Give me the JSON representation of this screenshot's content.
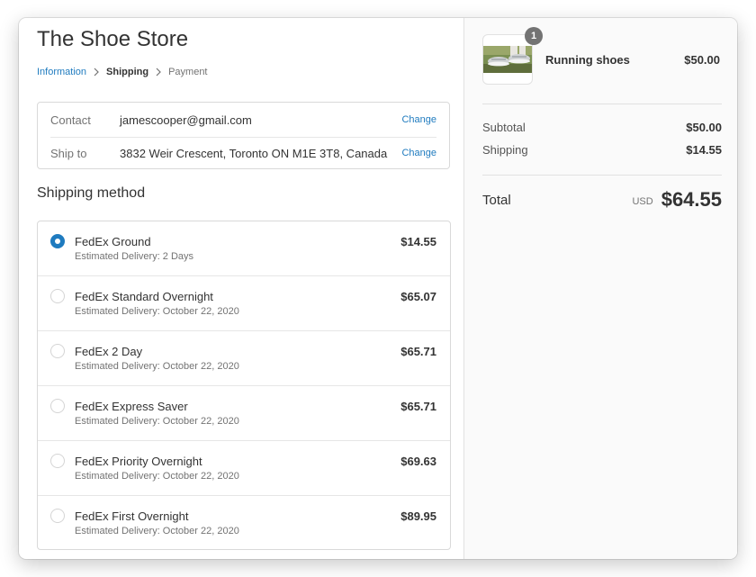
{
  "store": {
    "title": "The Shoe Store"
  },
  "breadcrumb": {
    "information": "Information",
    "shipping": "Shipping",
    "payment": "Payment"
  },
  "review": {
    "contact": {
      "label": "Contact",
      "value": "jamescooper@gmail.com",
      "change": "Change"
    },
    "ship_to": {
      "label": "Ship to",
      "value": "3832 Weir Crescent, Toronto ON M1E 3T8, Canada",
      "change": "Change"
    }
  },
  "shipping_method": {
    "title": "Shipping method",
    "options": [
      {
        "name": "FedEx Ground",
        "eta": "Estimated Delivery: 2 Days",
        "price": "$14.55",
        "selected": true
      },
      {
        "name": "FedEx Standard Overnight",
        "eta": "Estimated Delivery: October 22, 2020",
        "price": "$65.07",
        "selected": false
      },
      {
        "name": "FedEx 2 Day",
        "eta": "Estimated Delivery: October 22, 2020",
        "price": "$65.71",
        "selected": false
      },
      {
        "name": "FedEx Express Saver",
        "eta": "Estimated Delivery: October 22, 2020",
        "price": "$65.71",
        "selected": false
      },
      {
        "name": "FedEx Priority Overnight",
        "eta": "Estimated Delivery: October 22, 2020",
        "price": "$69.63",
        "selected": false
      },
      {
        "name": "FedEx First Overnight",
        "eta": "Estimated Delivery: October 22, 2020",
        "price": "$89.95",
        "selected": false
      }
    ]
  },
  "order_summary": {
    "product": {
      "name": "Running shoes",
      "price": "$50.00",
      "quantity": "1",
      "image_icon": "running-shoes-photo"
    },
    "subtotal": {
      "label": "Subtotal",
      "value": "$50.00"
    },
    "shipping": {
      "label": "Shipping",
      "value": "$14.55"
    },
    "total": {
      "label": "Total",
      "currency": "USD",
      "value": "$64.55"
    }
  },
  "colors": {
    "accent": "#1f7bbf",
    "text": "#333333",
    "muted": "#737373",
    "sidebar_bg": "#fafafa",
    "border": "#d9d9d9"
  }
}
